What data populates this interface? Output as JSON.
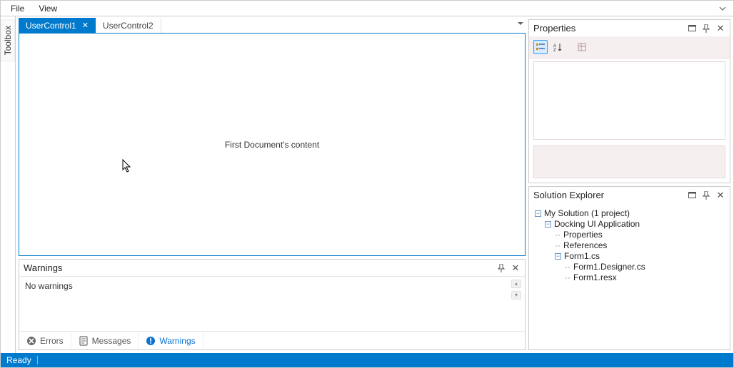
{
  "menu": {
    "file": "File",
    "view": "View"
  },
  "toolbox_label": "Toolbox",
  "document_tabs": [
    {
      "label": "UserControl1",
      "active": true
    },
    {
      "label": "UserControl2",
      "active": false
    }
  ],
  "document_body": "First Document's content",
  "bottom_panel": {
    "title": "Warnings",
    "body": "No warnings",
    "tabs": [
      {
        "label": "Errors",
        "icon": "error-icon",
        "active": false
      },
      {
        "label": "Messages",
        "icon": "messages-icon",
        "active": false
      },
      {
        "label": "Warnings",
        "icon": "warning-icon",
        "active": true
      }
    ]
  },
  "properties_panel": {
    "title": "Properties"
  },
  "solution_explorer": {
    "title": "Solution Explorer",
    "tree": {
      "root": "My Solution (1 project)",
      "project": "Docking UI Application",
      "properties": "Properties",
      "references": "References",
      "form": "Form1.cs",
      "designer": "Form1.Designer.cs",
      "resx": "Form1.resx"
    }
  },
  "status": {
    "text": "Ready"
  },
  "colors": {
    "accent": "#007ACC"
  }
}
